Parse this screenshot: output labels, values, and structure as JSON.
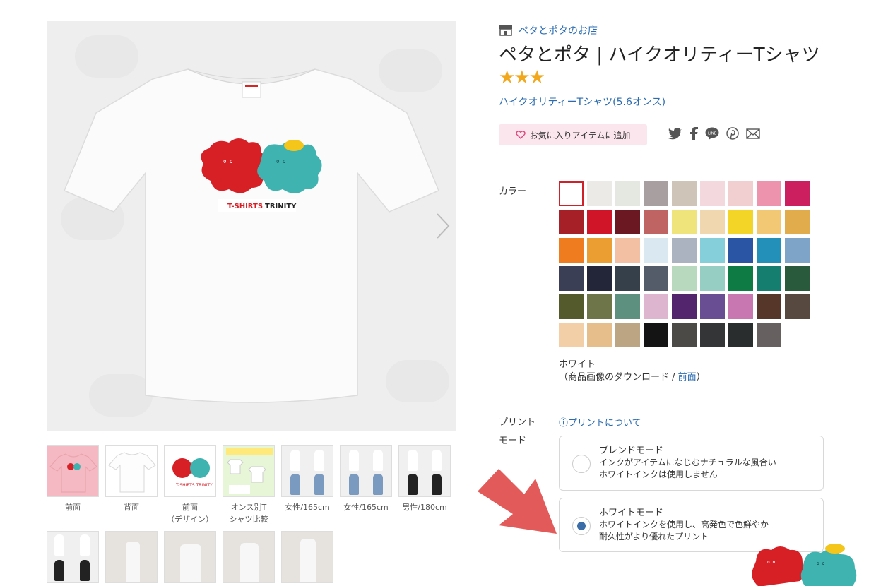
{
  "shop": {
    "name": "ペタとポタのお店",
    "icon": "store-icon"
  },
  "product": {
    "title": "ペタとポタ | ハイクオリティーTシャツ",
    "title_stars": "★★★",
    "subtitle": "ハイクオリティーTシャツ(5.6オンス)"
  },
  "main_image": {
    "print_text": "T-SHIRTS TRINITY",
    "next_icon": "chevron-right-icon"
  },
  "favorite": {
    "label": "お気に入りアイテムに追加",
    "icon": "heart-icon"
  },
  "share": [
    {
      "icon": "twitter-icon",
      "glyph": "🐦"
    },
    {
      "icon": "facebook-icon",
      "glyph": "f"
    },
    {
      "icon": "line-icon",
      "glyph": "LINE"
    },
    {
      "icon": "pinterest-icon",
      "glyph": "℗"
    },
    {
      "icon": "mail-icon",
      "glyph": "✉"
    }
  ],
  "thumbnails": [
    {
      "label": "前面",
      "label2": ""
    },
    {
      "label": "背面",
      "label2": ""
    },
    {
      "label": "前面",
      "label2": "（デザイン）"
    },
    {
      "label": "オンス別T",
      "label2": "シャツ比較"
    },
    {
      "label": "女性/165cm",
      "label2": ""
    },
    {
      "label": "女性/165cm",
      "label2": ""
    },
    {
      "label": "男性/180cm",
      "label2": ""
    },
    {
      "label": "",
      "label2": ""
    },
    {
      "label": "",
      "label2": ""
    },
    {
      "label": "",
      "label2": ""
    },
    {
      "label": "",
      "label2": ""
    },
    {
      "label": "",
      "label2": ""
    }
  ],
  "color": {
    "label": "カラー",
    "selected_name": "ホワイト",
    "download_prefix": "（商品画像のダウンロード / ",
    "download_link": "前面",
    "download_suffix": "）",
    "swatches": [
      "#ffffff",
      "#ebeae6",
      "#e5e8e1",
      "#a79fa0",
      "#cfc4b8",
      "#f3d8de",
      "#f1cfd0",
      "#ee93ad",
      "#cc1f5f",
      "#a52027",
      "#cf1527",
      "#6b1822",
      "#c06463",
      "#efe47b",
      "#f1d7b0",
      "#f2d526",
      "#f2c874",
      "#e0ac4c",
      "#ef7d20",
      "#eb9f33",
      "#f3c0a4",
      "#d9e8f1",
      "#aab3bf",
      "#84cfd9",
      "#2a55a5",
      "#2390b9",
      "#7ea4c8",
      "#3a3f56",
      "#232539",
      "#35404a",
      "#555c69",
      "#b8d9bd",
      "#96cec4",
      "#0e7b45",
      "#167e6f",
      "#285a3b",
      "#555a2c",
      "#6e7549",
      "#5e9080",
      "#deb5cf",
      "#53256d",
      "#6a4e93",
      "#c877b0",
      "#553628",
      "#57493f",
      "#f2cfa6",
      "#e6be8b",
      "#bca582",
      "#141414",
      "#4b4a47",
      "#333537",
      "#2a2d2e",
      "#666060"
    ]
  },
  "print_mode": {
    "label_line1": "プリント",
    "label_line2": "モード",
    "about_link": "プリントについて",
    "about_icon": "question-circle-icon",
    "options": [
      {
        "title": "ブレンドモード",
        "line1": "インクがアイテムになじむナチュラルな風合い",
        "line2": "ホワイトインクは使用しません",
        "checked": false
      },
      {
        "title": "ホワイトモード",
        "line1": "ホワイトインクを使用し、高発色で色鮮やか",
        "line2": "耐久性がより優れたプリント",
        "checked": true
      }
    ]
  }
}
